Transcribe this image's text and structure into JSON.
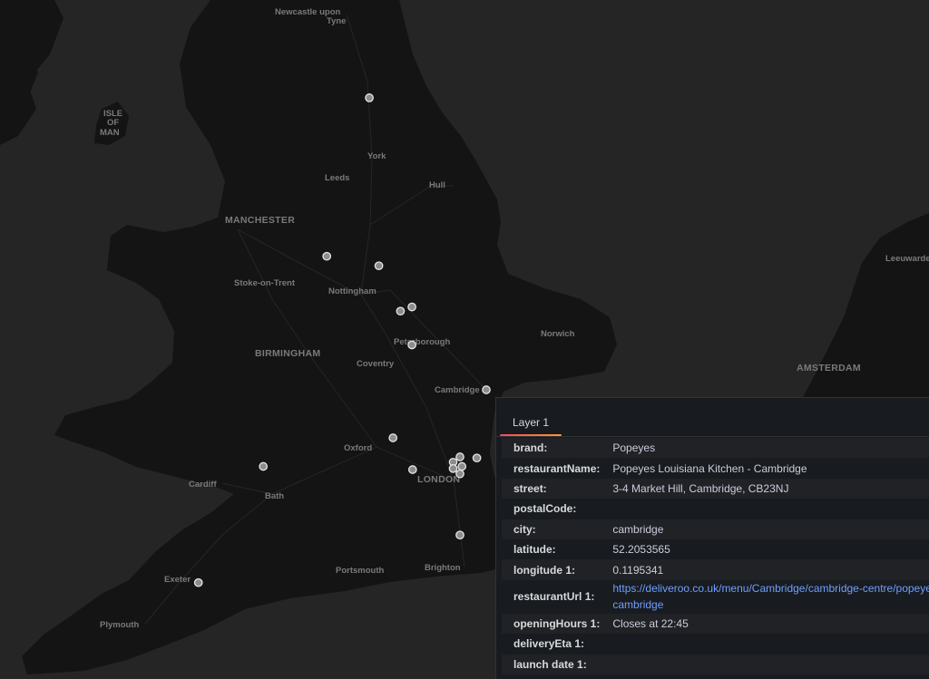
{
  "map": {
    "labels": [
      {
        "key": "newcastle_1",
        "text": "Newcastle upon"
      },
      {
        "key": "newcastle_2",
        "text": "Tyne"
      },
      {
        "key": "isle_1",
        "text": "ISLE"
      },
      {
        "key": "isle_2",
        "text": "OF"
      },
      {
        "key": "isle_3",
        "text": "MAN"
      },
      {
        "key": "york",
        "text": "York"
      },
      {
        "key": "leeds",
        "text": "Leeds"
      },
      {
        "key": "hull",
        "text": "Hull"
      },
      {
        "key": "manchester",
        "text": "MANCHESTER"
      },
      {
        "key": "stoke",
        "text": "Stoke-on-Trent"
      },
      {
        "key": "nottingham",
        "text": "Nottingham"
      },
      {
        "key": "peterborough",
        "text": "Peterborough"
      },
      {
        "key": "norwich",
        "text": "Norwich"
      },
      {
        "key": "birmingham",
        "text": "BIRMINGHAM"
      },
      {
        "key": "coventry",
        "text": "Coventry"
      },
      {
        "key": "cambridge",
        "text": "Cambridge"
      },
      {
        "key": "oxford",
        "text": "Oxford"
      },
      {
        "key": "london",
        "text": "LONDON"
      },
      {
        "key": "cardiff",
        "text": "Cardiff"
      },
      {
        "key": "bath",
        "text": "Bath"
      },
      {
        "key": "exeter",
        "text": "Exeter"
      },
      {
        "key": "portsmouth",
        "text": "Portsmouth"
      },
      {
        "key": "brighton",
        "text": "Brighton"
      },
      {
        "key": "plymouth",
        "text": "Plymouth"
      },
      {
        "key": "amsterdam",
        "text": "AMSTERDAM"
      },
      {
        "key": "leeuwarden",
        "text": "Leeuwarden"
      }
    ],
    "markers": [
      {
        "name": "marker-newcastle",
        "lat": 54.97,
        "lon": -1.61
      },
      {
        "name": "marker-manchester",
        "lat": 53.47,
        "lon": -2.24
      },
      {
        "name": "marker-sheffield",
        "lat": 53.38,
        "lon": -1.47
      },
      {
        "name": "marker-nottingham-1",
        "lat": 52.95,
        "lon": -1.15
      },
      {
        "name": "marker-nottingham-2",
        "lat": 52.99,
        "lon": -0.98
      },
      {
        "name": "marker-leicester",
        "lat": 52.63,
        "lon": -0.98
      },
      {
        "name": "marker-cambridge",
        "lat": 52.2053565,
        "lon": 0.1195341
      },
      {
        "name": "marker-oxford",
        "lat": 51.75,
        "lon": -1.26
      },
      {
        "name": "marker-cardiff",
        "lat": 51.48,
        "lon": -3.18
      },
      {
        "name": "marker-reading",
        "lat": 51.45,
        "lon": -0.97
      },
      {
        "name": "marker-london-1",
        "lat": 51.52,
        "lon": -0.37
      },
      {
        "name": "marker-london-2",
        "lat": 51.46,
        "lon": -0.37
      },
      {
        "name": "marker-london-3",
        "lat": 51.57,
        "lon": -0.27
      },
      {
        "name": "marker-london-4",
        "lat": 51.48,
        "lon": -0.24
      },
      {
        "name": "marker-london-5",
        "lat": 51.41,
        "lon": -0.27
      },
      {
        "name": "marker-london-6",
        "lat": 51.56,
        "lon": -0.02
      },
      {
        "name": "marker-brighton",
        "lat": 50.83,
        "lon": -0.27
      },
      {
        "name": "marker-plymouth",
        "lat": 50.38,
        "lon": -4.14
      }
    ]
  },
  "tooltip": {
    "tab_label": "Layer 1",
    "rows": [
      {
        "key": "brand:",
        "value": "Popeyes"
      },
      {
        "key": "restaurantName:",
        "value": "Popeyes Louisiana Kitchen - Cambridge"
      },
      {
        "key": "street:",
        "value": "3-4 Market Hill, Cambridge, CB23NJ"
      },
      {
        "key": "postalCode:",
        "value": ""
      },
      {
        "key": "city:",
        "value": "cambridge"
      },
      {
        "key": "latitude:",
        "value": "52.2053565"
      },
      {
        "key": "longitude 1:",
        "value": "0.1195341"
      },
      {
        "key": "restaurantUrl 1:",
        "value": "https://deliveroo.co.uk/menu/Cambridge/cambridge-centre/popeyes-cambridge"
      },
      {
        "key": "openingHours 1:",
        "value": "Closes at 22:45"
      },
      {
        "key": "deliveryEta 1:",
        "value": ""
      },
      {
        "key": "launch date 1:",
        "value": ""
      }
    ]
  },
  "colors": {
    "background": "#252525",
    "land": "#141414",
    "panel": "#181b1f",
    "link": "#6e9fff",
    "tab_underline": "#ff9830"
  }
}
